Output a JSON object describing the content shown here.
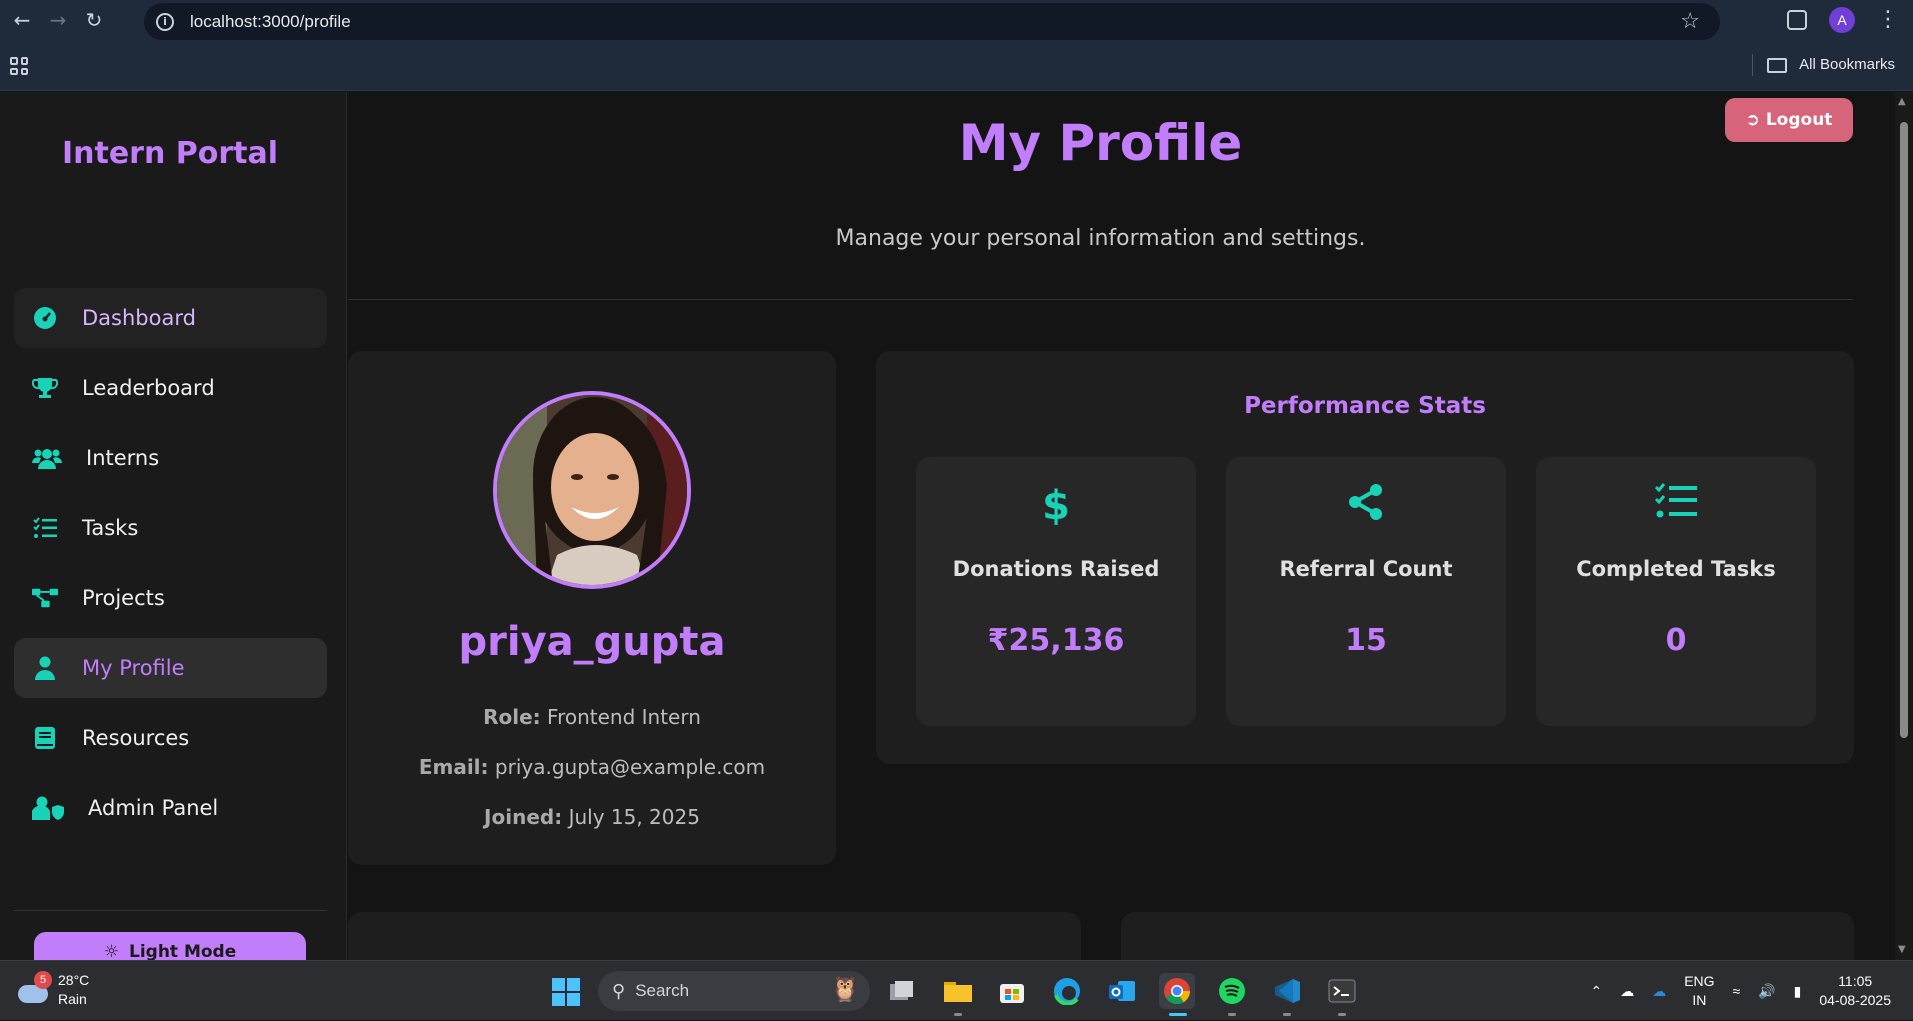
{
  "browser": {
    "url": "localhost:3000/profile",
    "profile_initial": "A",
    "bookmarks_label": "All Bookmarks"
  },
  "sidebar": {
    "brand": "Intern Portal",
    "items": [
      {
        "label": "Dashboard",
        "icon": "gauge-icon"
      },
      {
        "label": "Leaderboard",
        "icon": "trophy-icon"
      },
      {
        "label": "Interns",
        "icon": "users-icon"
      },
      {
        "label": "Tasks",
        "icon": "task-list-icon"
      },
      {
        "label": "Projects",
        "icon": "project-diagram-icon"
      },
      {
        "label": "My Profile",
        "icon": "user-icon"
      },
      {
        "label": "Resources",
        "icon": "book-icon"
      },
      {
        "label": "Admin Panel",
        "icon": "user-shield-icon"
      }
    ],
    "active_item": "My Profile",
    "theme_toggle": "Light Mode"
  },
  "header": {
    "logout": "Logout",
    "title": "My Profile",
    "subtitle": "Manage your personal information and settings."
  },
  "profile": {
    "username": "priya_gupta",
    "role_label": "Role:",
    "role": "Frontend Intern",
    "email_label": "Email:",
    "email": "priya.gupta@example.com",
    "joined_label": "Joined:",
    "joined": "July 15, 2025"
  },
  "stats": {
    "title": "Performance Stats",
    "items": [
      {
        "icon": "dollar-icon",
        "label": "Donations Raised",
        "value": "₹25,136"
      },
      {
        "icon": "share-icon",
        "label": "Referral Count",
        "value": "15"
      },
      {
        "icon": "list-check-icon",
        "label": "Completed Tasks",
        "value": "0"
      }
    ]
  },
  "colors": {
    "accent": "#c27dfb",
    "teal": "#19d3b9",
    "logout": "#d6647a",
    "background": "#141414"
  },
  "taskbar": {
    "weather_badge": "5",
    "temperature": "28°C",
    "condition": "Rain",
    "search_placeholder": "Search",
    "lang_1": "ENG",
    "lang_2": "IN",
    "time": "11:05",
    "date": "04-08-2025"
  }
}
